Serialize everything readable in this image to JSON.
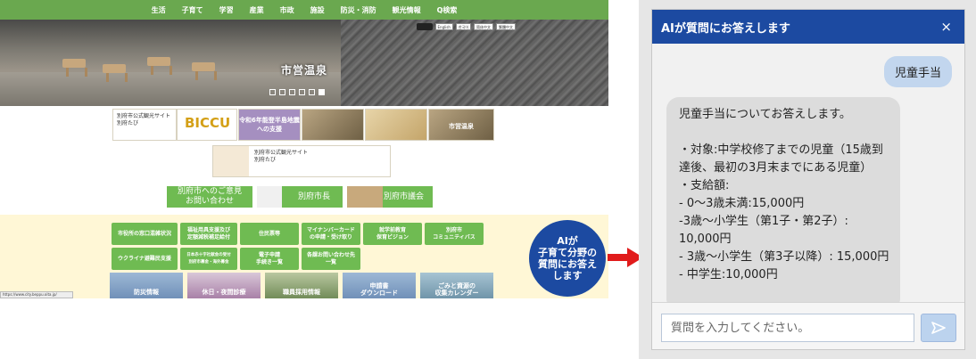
{
  "site": {
    "nav": [
      "生活",
      "子育て",
      "学習",
      "産業",
      "市政",
      "施設",
      "防災・消防",
      "観光情報",
      "Q検索"
    ],
    "utility": [
      "English",
      "한국어",
      "简体中文",
      "繁體中文"
    ],
    "hero_caption": "市営温泉",
    "banners": {
      "kankou_site": "別府市公式観光サイト\n別府たび",
      "biccu": "BICCU",
      "support": "令和6年能登半島地震\nへの支援",
      "onsen": "市営温泉",
      "kankou_site2": "別府市公式観光サイト\n別府たび"
    },
    "green_buttons": {
      "opinion": "別府市へのご意見\nお問い合わせ",
      "mayor": "別府市長",
      "council": "別府市議会"
    },
    "pills": [
      "市役所の窓口混雑状況",
      "福祉用具支援及び\n定額減税補足給付",
      "住民票等",
      "マイナンバーカード\nの申請・受け取り",
      "就学前教育\n保育ビジョン",
      "別府市\nコミュニティバス",
      "ウクライナ避難民支援",
      "日本赤十字社献金の受付\n別府市募金・海外募金",
      "電子申請\n手続き一覧",
      "各課お問い合わせ先\n一覧"
    ],
    "tiles": [
      "防災情報",
      "休日・夜間診療",
      "職員採用情報",
      "申請書\nダウンロード",
      "ごみと資源の\n収集カレンダー"
    ],
    "url": "https://www.city.beppu.oita.jp/"
  },
  "badge": "AIが\n子育て分野の\n質問にお答え\nします",
  "chat": {
    "title": "AIが質問にお答えします",
    "close_label": "×",
    "user_message": "児童手当",
    "bot_message": "児童手当についてお答えします。\n\n・対象:中学校修了までの児童（15歳到達後、最初の3月末までにある児童）\n・支給額:\n- 0〜3歳未満:15,000円\n-3歳〜小学生（第1子・第2子）:\n10,000円\n- 3歳〜小学生（第3子以降）: 15,000円\n- 中学生:10,000円",
    "input_placeholder": "質問を入力してください。"
  },
  "colors": {
    "header_blue": "#1c4aa1",
    "nav_green": "#6aa84f",
    "arrow_red": "#e11b1b",
    "user_bubble": "#c2d6ee",
    "bot_bubble": "#dcdcdc"
  },
  "icons": {
    "send": "send-icon",
    "close": "close-icon",
    "arrow": "right-arrow-icon"
  }
}
